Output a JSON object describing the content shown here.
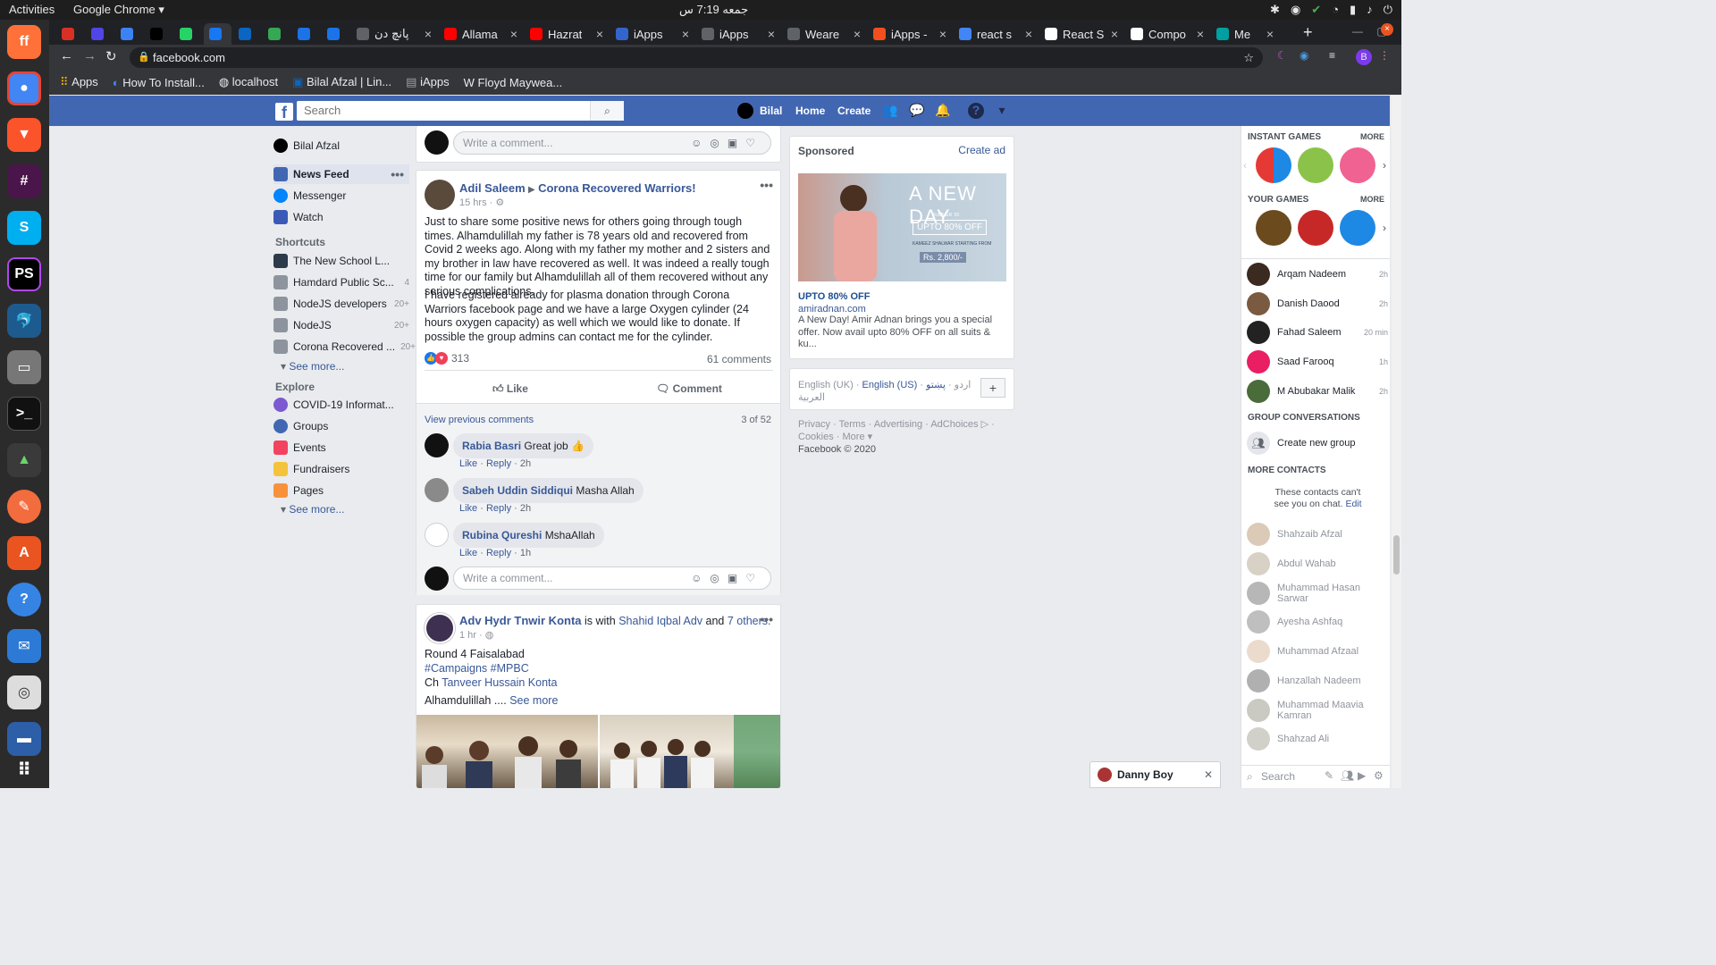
{
  "gnome": {
    "activities": "Activities",
    "app_menu": "Google Chrome ▾",
    "clock": "جمعه 7:19 س"
  },
  "tabs": [
    {
      "label": "",
      "color": "#d93025"
    },
    {
      "label": "",
      "color": "#4f46e5"
    },
    {
      "label": "",
      "color": "#3b82f6"
    },
    {
      "label": "DEV",
      "color": "#000000"
    },
    {
      "label": "",
      "color": "#25d366"
    },
    {
      "label": "",
      "color": "#1877f2"
    },
    {
      "label": "",
      "color": "#0a66c2"
    },
    {
      "label": "",
      "color": "#34a853"
    },
    {
      "label": "",
      "color": "#1a73e8"
    },
    {
      "label": "",
      "color": "#1a73e8"
    },
    {
      "label": "پانچ دن",
      "color": "#5f6368"
    },
    {
      "label": "Allama",
      "color": "#ff0000"
    },
    {
      "label": "Hazrat",
      "color": "#ff0000"
    },
    {
      "label": "iApps",
      "color": "#3366cc"
    },
    {
      "label": "iApps",
      "color": "#5f6368"
    },
    {
      "label": "Weare",
      "color": "#5f6368"
    },
    {
      "label": "iApps -",
      "color": "#f24e1e"
    },
    {
      "label": "react s",
      "color": "#4285f4"
    },
    {
      "label": "React S",
      "color": "#ffffff"
    },
    {
      "label": "Compo",
      "color": "#ffffff"
    },
    {
      "label": "Me",
      "color": "#00a0a0"
    }
  ],
  "browser": {
    "url": "facebook.com",
    "bookmarks": [
      "Apps",
      "How To Install...",
      "localhost",
      "Bilal Afzal | Lin...",
      "iApps",
      "Floyd Maywea..."
    ]
  },
  "fb_header": {
    "search_placeholder": "Search",
    "user": "Bilal",
    "home": "Home",
    "create": "Create"
  },
  "left_nav": {
    "user": "Bilal Afzal",
    "main": [
      {
        "label": "News Feed"
      },
      {
        "label": "Messenger"
      },
      {
        "label": "Watch"
      }
    ],
    "shortcuts_title": "Shortcuts",
    "shortcuts": [
      {
        "label": "The New School L...",
        "count": ""
      },
      {
        "label": "Hamdard Public Sc...",
        "count": "4"
      },
      {
        "label": "NodeJS developers",
        "count": "20+"
      },
      {
        "label": "NodeJS",
        "count": "20+"
      },
      {
        "label": "Corona Recovered ...",
        "count": "20+"
      }
    ],
    "see_more": "See more...",
    "explore_title": "Explore",
    "explore": [
      {
        "label": "COVID-19 Informat..."
      },
      {
        "label": "Groups"
      },
      {
        "label": "Events"
      },
      {
        "label": "Fundraisers"
      },
      {
        "label": "Pages"
      }
    ]
  },
  "top_comment_box": {
    "placeholder": "Write a comment..."
  },
  "post1": {
    "author": "Adil Saleem",
    "group": "Corona Recovered Warriors!",
    "time": "15 hrs ·",
    "para1": "Just to share some positive news for others going through tough times. Alhamdulillah my father is 78 years old and recovered from Covid 2 weeks ago. Along with my father my mother and 2 sisters and my brother in law have recovered as well. It was indeed a really tough time for our family but Alhamdulillah all of them recovered without any serious complications.",
    "para2": "I have registered already for plasma donation through Corona Warriors facebook page and we have a large Oxygen cylinder (24 hours oxygen capacity) as well which we would like to donate. If possible the group admins can contact me for the cylinder.",
    "reactions": "313",
    "comments_count": "61 comments",
    "like": "Like",
    "comment": "Comment",
    "view_previous": "View previous comments",
    "pager": "3 of 52",
    "comments": [
      {
        "name": "Rabia Basri",
        "text": "Great job 👍",
        "like": "Like",
        "reply": "Reply",
        "time": "2h"
      },
      {
        "name": "Sabeh Uddin Siddiqui",
        "text": "Masha Allah",
        "like": "Like",
        "reply": "Reply",
        "time": "2h"
      },
      {
        "name": "Rubina Qureshi",
        "text": "MshaAllah",
        "like": "Like",
        "reply": "Reply",
        "time": "1h"
      }
    ],
    "write_placeholder": "Write a comment..."
  },
  "post2": {
    "author": "Adv Hydr Tnwir Konta",
    "is_with": "is with",
    "with_name": "Shahid Iqbal Adv",
    "and": "and",
    "others": "7 others.",
    "time": "1 hr ·",
    "line1": "Round 4 Faisalabad",
    "line2": "#Campaigns #MPBC",
    "line3_prefix": "Ch",
    "line3_link": "Tanveer Hussain Konta",
    "line4": "Alhamdulillah ....",
    "see_more": "See more"
  },
  "sponsored": {
    "title": "Sponsored",
    "create_ad": "Create ad",
    "ad_headline": "A NEW DAY",
    "ad_tag": "UPTO 80% OFF",
    "ad_small": "SUMMER '20",
    "ad_sub": "KAMEEZ SHALWAR STARTING FROM",
    "ad_price": "Rs. 2,800/-",
    "headline": "UPTO 80% OFF",
    "domain": "amiradnan.com",
    "desc": "A New Day! Amir Adnan brings you a special offer. Now avail upto 80% OFF on all suits & ku..."
  },
  "languages": {
    "uk": "English (UK)",
    "dot": "·",
    "us": "English (US)",
    "urdu": "اردو",
    "pashto": "پښتو",
    "arabic": "العربية",
    "plus": "+"
  },
  "footer": {
    "line1": "Privacy · Terms · Advertising · AdChoices ▷ ·",
    "line2": "Cookies · More ▾",
    "copyright": "Facebook © 2020"
  },
  "right_chat": {
    "instant_games": "INSTANT GAMES",
    "your_games": "YOUR GAMES",
    "more": "MORE",
    "online": [
      {
        "name": "Arqam Nadeem",
        "time": "2h"
      },
      {
        "name": "Danish Daood",
        "time": "2h"
      },
      {
        "name": "Fahad Saleem",
        "time": "20 min"
      },
      {
        "name": "Saad Farooq",
        "time": "1h"
      },
      {
        "name": "M Abubakar Malik",
        "time": "2h"
      }
    ],
    "group_conv": "GROUP CONVERSATIONS",
    "create_group": "Create new group",
    "more_contacts": "MORE CONTACTS",
    "notice": "These contacts can't see you on chat.",
    "edit": "Edit",
    "offline": [
      "Shahzaib Afzal",
      "Abdul Wahab",
      "Muhammad Hasan Sarwar",
      "Ayesha Ashfaq",
      "Muhammad Afzaal",
      "Hanzallah Nadeem",
      "Muhammad Maavia Kamran",
      "Shahzad Ali"
    ],
    "search": "Search"
  },
  "chat_tab": {
    "name": "Danny Boy",
    "close": "✕"
  }
}
